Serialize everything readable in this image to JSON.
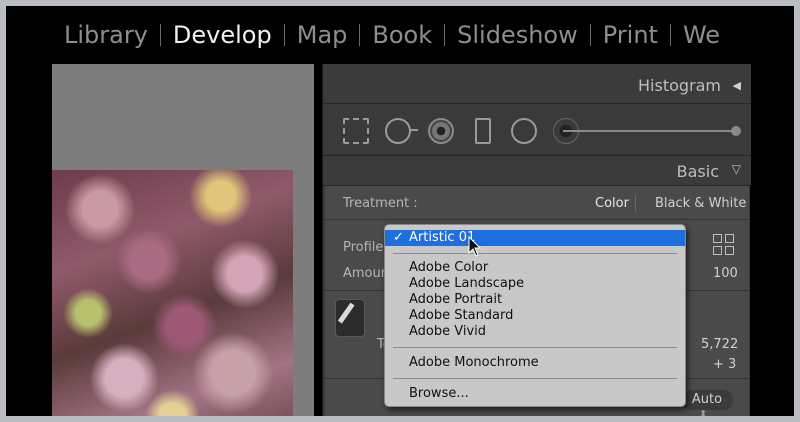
{
  "modules": [
    {
      "label": "Library",
      "active": false
    },
    {
      "label": "Develop",
      "active": true
    },
    {
      "label": "Map",
      "active": false
    },
    {
      "label": "Book",
      "active": false
    },
    {
      "label": "Slideshow",
      "active": false
    },
    {
      "label": "Print",
      "active": false
    },
    {
      "label": "We",
      "active": false
    }
  ],
  "histogram": {
    "title": "Histogram"
  },
  "basic": {
    "title": "Basic",
    "treatment_label": "Treatment :",
    "treatment_color": "Color",
    "treatment_bw": "Black & White",
    "profile_label": "Profile :",
    "amount_label": "Amount",
    "amount_value": "100",
    "temp_label_partial": "Te",
    "temp_value": "5,722",
    "tint_label_partial": "T",
    "tint_value": "+ 3",
    "auto_label": "Auto"
  },
  "profile_menu": {
    "selected": "Artistic 01",
    "groups": [
      [
        "Adobe Color",
        "Adobe Landscape",
        "Adobe Portrait",
        "Adobe Standard",
        "Adobe Vivid"
      ],
      [
        "Adobe Monochrome"
      ],
      [
        "Browse..."
      ]
    ],
    "selection_color": "#1d6fe0"
  }
}
